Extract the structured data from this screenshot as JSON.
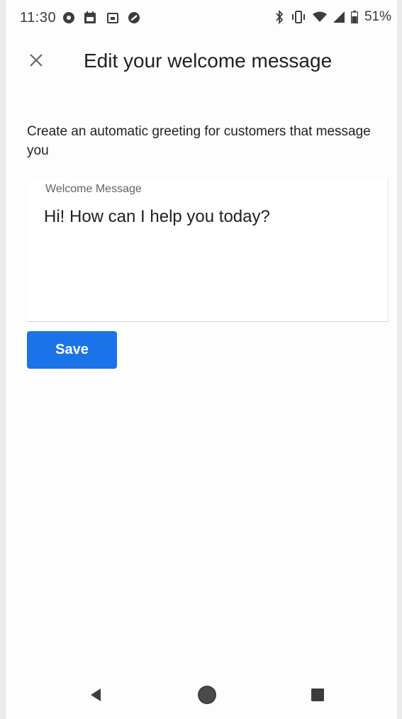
{
  "status_bar": {
    "time": "11:30",
    "notification_icons": [
      "settings-badge-icon",
      "calendar-icon",
      "calendar-small-icon",
      "no-disturb-icon"
    ],
    "right_icons": [
      "bluetooth-icon",
      "vibrate-icon",
      "wifi-icon",
      "signal-icon",
      "battery-icon"
    ],
    "battery_percent": "51%"
  },
  "app_bar": {
    "close_icon": "close-icon",
    "title": "Edit your welcome message"
  },
  "content": {
    "description": "Create an automatic greeting for customers that message you",
    "field": {
      "label": "Welcome Message",
      "value": "Hi! How can I help you today?"
    },
    "save_label": "Save"
  },
  "nav_bar": {
    "buttons": [
      "back-icon",
      "home-icon",
      "recents-icon"
    ]
  },
  "colors": {
    "accent": "#1a73e8",
    "text": "#202124",
    "label": "#5f6368"
  }
}
